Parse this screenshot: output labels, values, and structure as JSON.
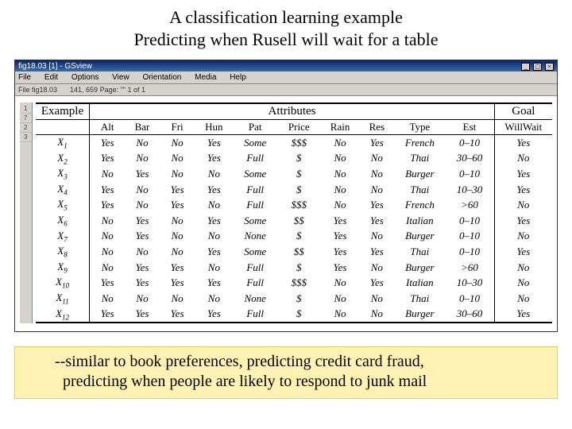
{
  "slide": {
    "title_line1": "A classification learning example",
    "title_line2": "Predicting when Rusell will wait for a table"
  },
  "window": {
    "title": "fig18.03 [1] - GSview",
    "menu": [
      "File",
      "Edit",
      "Options",
      "View",
      "Orientation",
      "Media",
      "Help"
    ],
    "toolbar": {
      "file": "File fig18.03",
      "page": "141, 659   Page: \"\"  1 of 1"
    },
    "ruler": [
      "1",
      "7",
      "2",
      "3"
    ],
    "sys_buttons": [
      "_",
      "▢",
      "×"
    ]
  },
  "table": {
    "top_headers": {
      "example": "Example",
      "attributes": "Attributes",
      "goal": "Goal"
    },
    "sub_headers": [
      "Alt",
      "Bar",
      "Fri",
      "Hun",
      "Pat",
      "Price",
      "Rain",
      "Res",
      "Type",
      "Est",
      "WillWait"
    ],
    "rows": [
      {
        "ex": "1",
        "v": [
          "Yes",
          "No",
          "No",
          "Yes",
          "Some",
          "$$$",
          "No",
          "Yes",
          "French",
          "0–10",
          "Yes"
        ]
      },
      {
        "ex": "2",
        "v": [
          "Yes",
          "No",
          "No",
          "Yes",
          "Full",
          "$",
          "No",
          "No",
          "Thai",
          "30–60",
          "No"
        ]
      },
      {
        "ex": "3",
        "v": [
          "No",
          "Yes",
          "No",
          "No",
          "Some",
          "$",
          "No",
          "No",
          "Burger",
          "0–10",
          "Yes"
        ]
      },
      {
        "ex": "4",
        "v": [
          "Yes",
          "No",
          "Yes",
          "Yes",
          "Full",
          "$",
          "No",
          "No",
          "Thai",
          "10–30",
          "Yes"
        ]
      },
      {
        "ex": "5",
        "v": [
          "Yes",
          "No",
          "Yes",
          "No",
          "Full",
          "$$$",
          "No",
          "Yes",
          "French",
          ">60",
          "No"
        ]
      },
      {
        "ex": "6",
        "v": [
          "No",
          "Yes",
          "No",
          "Yes",
          "Some",
          "$$",
          "Yes",
          "Yes",
          "Italian",
          "0–10",
          "Yes"
        ]
      },
      {
        "ex": "7",
        "v": [
          "No",
          "Yes",
          "No",
          "No",
          "None",
          "$",
          "Yes",
          "No",
          "Burger",
          "0–10",
          "No"
        ]
      },
      {
        "ex": "8",
        "v": [
          "No",
          "No",
          "No",
          "Yes",
          "Some",
          "$$",
          "Yes",
          "Yes",
          "Thai",
          "0–10",
          "Yes"
        ]
      },
      {
        "ex": "9",
        "v": [
          "No",
          "Yes",
          "Yes",
          "No",
          "Full",
          "$",
          "Yes",
          "No",
          "Burger",
          ">60",
          "No"
        ]
      },
      {
        "ex": "10",
        "v": [
          "Yes",
          "Yes",
          "Yes",
          "Yes",
          "Full",
          "$$$",
          "No",
          "Yes",
          "Italian",
          "10–30",
          "No"
        ]
      },
      {
        "ex": "11",
        "v": [
          "No",
          "No",
          "No",
          "No",
          "None",
          "$",
          "No",
          "No",
          "Thai",
          "0–10",
          "No"
        ]
      },
      {
        "ex": "12",
        "v": [
          "Yes",
          "Yes",
          "Yes",
          "Yes",
          "Full",
          "$",
          "No",
          "No",
          "Burger",
          "30–60",
          "Yes"
        ]
      }
    ]
  },
  "caption": {
    "line1": "--similar to book preferences, predicting credit card fraud,",
    "line2": "predicting when people are likely to respond to junk mail"
  }
}
